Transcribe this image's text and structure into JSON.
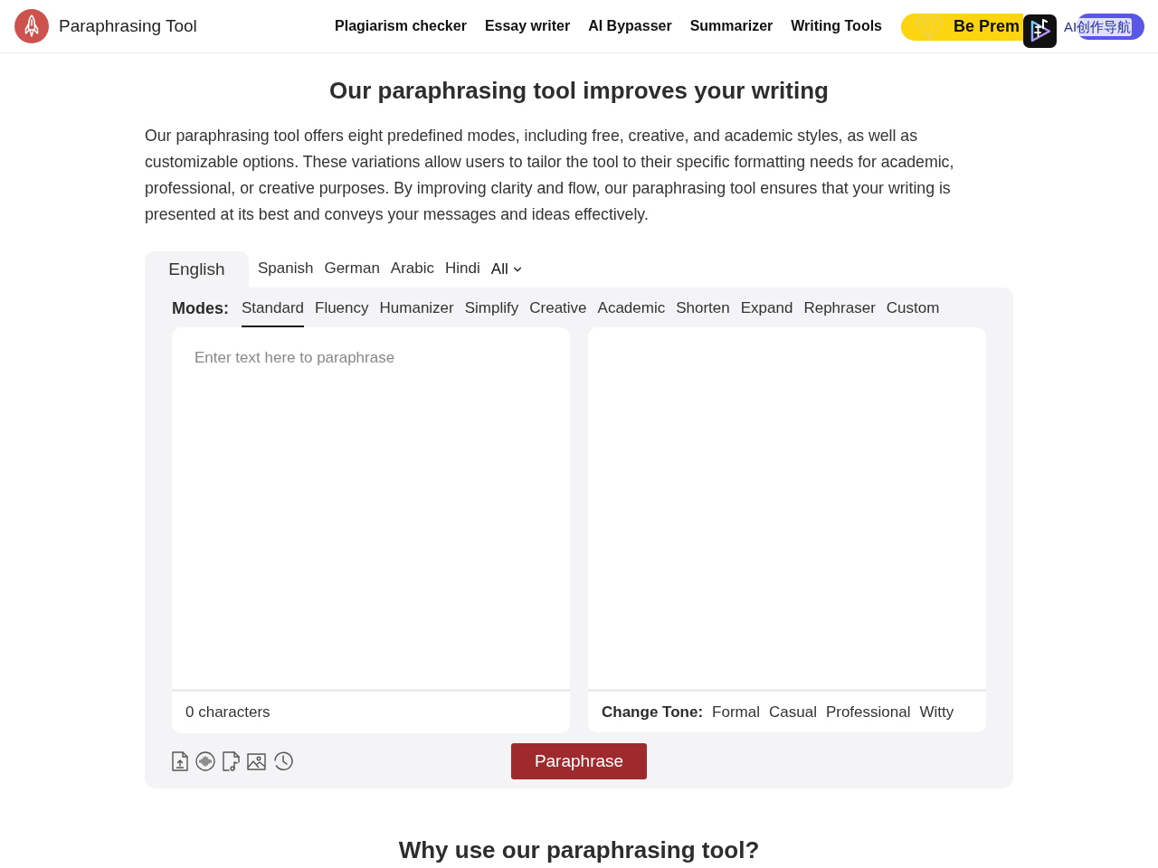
{
  "header": {
    "logo_text": "Paraphrasing Tool",
    "nav": [
      "Plagiarism checker",
      "Essay writer",
      "AI Bypasser",
      "Summarizer",
      "Writing Tools"
    ],
    "premium_button": "Be Prem",
    "overlay_label": "AI创作导航"
  },
  "title": "Our paraphrasing tool improves your writing",
  "intro": "Our paraphrasing tool offers eight predefined modes, including free, creative, and academic styles, as well as customizable options. These variations allow users to tailor the tool to their specific formatting needs for academic, professional, or creative purposes. By improving clarity and flow, our paraphrasing tool ensures that your writing is presented at its best and conveys your messages and ideas effectively.",
  "languages": [
    {
      "label": "English",
      "kind": "tab",
      "selected": true
    },
    {
      "label": "Spanish",
      "kind": "tab",
      "selected": false
    },
    {
      "label": "German",
      "kind": "tab",
      "selected": false
    },
    {
      "label": "Arabic",
      "kind": "tab",
      "selected": false
    },
    {
      "label": "Hindi",
      "kind": "tab",
      "selected": false
    },
    {
      "label": "All",
      "kind": "dropdown",
      "selected": false
    }
  ],
  "modes_label": "Modes:",
  "modes": [
    {
      "label": "Standard",
      "selected": true
    },
    {
      "label": "Fluency",
      "selected": false
    },
    {
      "label": "Humanizer",
      "selected": false
    },
    {
      "label": "Simplify",
      "selected": false
    },
    {
      "label": "Creative",
      "selected": false
    },
    {
      "label": "Academic",
      "selected": false
    },
    {
      "label": "Shorten",
      "selected": false
    },
    {
      "label": "Expand",
      "selected": false
    },
    {
      "label": "Rephraser",
      "selected": false
    },
    {
      "label": "Custom",
      "selected": false
    }
  ],
  "input": {
    "placeholder": "Enter text here to paraphrase",
    "count": "0 characters"
  },
  "output": {
    "tone_label": "Change Tone:",
    "tones": [
      {
        "label": "Formal",
        "selected": false
      },
      {
        "label": "Casual",
        "selected": false
      },
      {
        "label": "Professional",
        "selected": false
      },
      {
        "label": "Witty",
        "selected": false
      }
    ]
  },
  "paraphrase_button": "Paraphrase",
  "section_title": "Why use our paraphrasing tool?"
}
